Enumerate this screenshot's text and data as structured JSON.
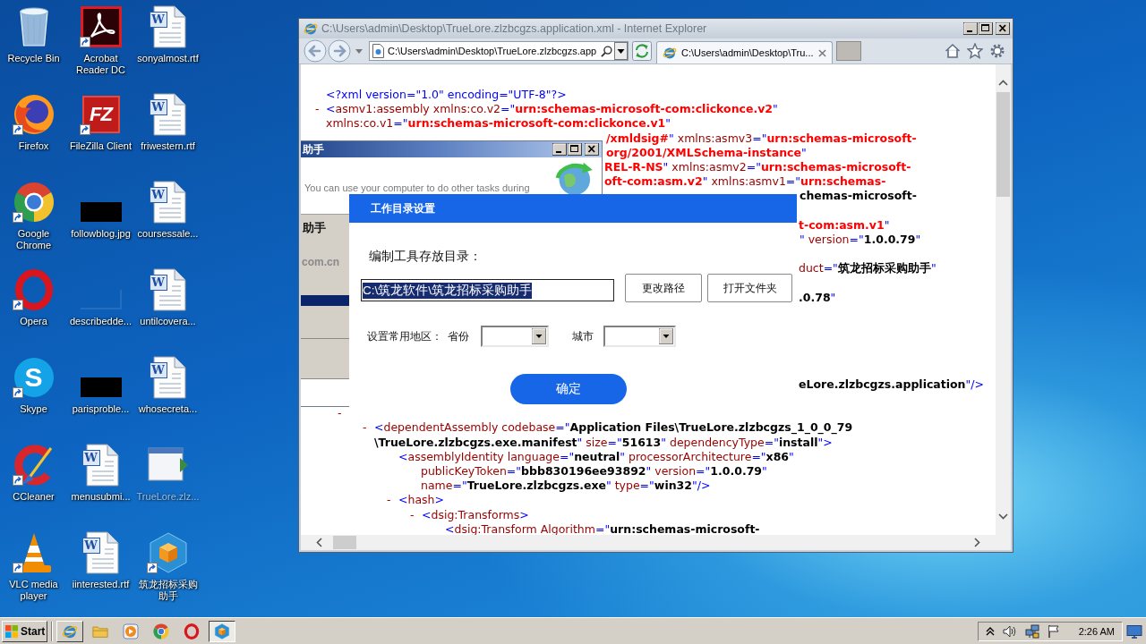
{
  "desktop": {
    "icons": [
      {
        "label": "Recycle Bin",
        "kind": "recycle-bin",
        "shortcut": false,
        "ghosted": false
      },
      {
        "label": "Firefox",
        "kind": "firefox",
        "shortcut": true,
        "ghosted": false
      },
      {
        "label": "Google Chrome",
        "kind": "chrome",
        "shortcut": true,
        "ghosted": false
      },
      {
        "label": "Opera",
        "kind": "opera",
        "shortcut": true,
        "ghosted": false
      },
      {
        "label": "Skype",
        "kind": "skype",
        "badge": "S",
        "shortcut": true,
        "ghosted": false
      },
      {
        "label": "CCleaner",
        "kind": "ccleaner",
        "shortcut": true,
        "ghosted": false
      },
      {
        "label": "VLC media player",
        "kind": "vlc",
        "shortcut": true,
        "ghosted": false
      },
      {
        "label": "Acrobat Reader DC",
        "kind": "acrobat",
        "shortcut": true,
        "ghosted": false
      },
      {
        "label": "FileZilla Client",
        "kind": "filezilla",
        "badge": "FZ",
        "shortcut": true,
        "ghosted": false
      },
      {
        "label": "followblog.jpg",
        "kind": "image",
        "shortcut": false,
        "ghosted": false
      },
      {
        "label": "describedde...",
        "kind": "image-blank",
        "shortcut": false,
        "ghosted": false
      },
      {
        "label": "parisproble...",
        "kind": "image",
        "shortcut": false,
        "ghosted": false
      },
      {
        "label": "menusubmi...",
        "kind": "document",
        "badge": "W",
        "shortcut": false,
        "ghosted": false
      },
      {
        "label": "iinterested.rtf",
        "kind": "document",
        "badge": "W",
        "shortcut": false,
        "ghosted": false
      },
      {
        "label": "sonyalmost.rtf",
        "kind": "document",
        "badge": "W",
        "shortcut": false,
        "ghosted": false
      },
      {
        "label": "friwestern.rtf",
        "kind": "document",
        "badge": "W",
        "shortcut": false,
        "ghosted": false
      },
      {
        "label": "coursessale...",
        "kind": "document",
        "badge": "W",
        "shortcut": false,
        "ghosted": false
      },
      {
        "label": "untilcovera...",
        "kind": "document",
        "badge": "W",
        "shortcut": false,
        "ghosted": false
      },
      {
        "label": "whosecreta...",
        "kind": "document",
        "badge": "W",
        "shortcut": false,
        "ghosted": false
      },
      {
        "label": "TrueLore.zlz...",
        "kind": "app-window",
        "shortcut": false,
        "ghosted": true
      },
      {
        "label": "筑龙招标采购助手",
        "kind": "cube-app",
        "shortcut": true,
        "ghosted": false
      }
    ]
  },
  "browser_window": {
    "title": "C:\\Users\\admin\\Desktop\\TrueLore.zlzbcgzs.application.xml - Internet Explorer",
    "active": false,
    "address": "C:\\Users\\admin\\Desktop\\TrueLore.zlzbcgzs.app",
    "tabs": [
      {
        "label": "C:\\Users\\admin\\Desktop\\Tru...",
        "selected": true
      }
    ],
    "xml_lines": [
      {
        "parts": [
          {
            "kind": "markup",
            "text": "<?xml version=\"1.0\" encoding=\"UTF-8\"?>"
          }
        ]
      },
      {
        "fold": "-",
        "parts": [
          {
            "kind": "markup",
            "text": "<"
          },
          {
            "kind": "name",
            "text": "asmv1:assembly"
          },
          {
            "kind": "name",
            "text": " xmlns:co.v2"
          },
          {
            "kind": "markup",
            "text": "=\""
          },
          {
            "kind": "ns",
            "text": "urn:schemas-microsoft-com:clickonce.v2"
          },
          {
            "kind": "markup",
            "text": "\""
          }
        ]
      },
      {
        "parts": [
          {
            "kind": "name",
            "text": "xmlns:co.v1"
          },
          {
            "kind": "markup",
            "text": "=\""
          },
          {
            "kind": "ns",
            "text": "urn:schemas-microsoft-com:clickonce.v1"
          },
          {
            "kind": "markup",
            "text": "\""
          }
        ]
      },
      {
        "parts": [
          {
            "kind": "ns",
            "text": "/xmldsig#"
          },
          {
            "kind": "markup",
            "text": "\""
          },
          {
            "kind": "name",
            "text": " xmlns:asmv3"
          },
          {
            "kind": "markup",
            "text": "=\""
          },
          {
            "kind": "ns",
            "text": "urn:schemas-microsoft-"
          }
        ]
      },
      {
        "parts": [
          {
            "kind": "ns",
            "text": "org/2001/XMLSchema-instance"
          },
          {
            "kind": "markup",
            "text": "\""
          }
        ]
      },
      {
        "parts": [
          {
            "kind": "ns",
            "text": "REL-R-NS"
          },
          {
            "kind": "markup",
            "text": "\""
          },
          {
            "kind": "name",
            "text": " xmlns:asmv2"
          },
          {
            "kind": "markup",
            "text": "=\""
          },
          {
            "kind": "ns",
            "text": "urn:schemas-microsoft-"
          }
        ]
      },
      {
        "parts": [
          {
            "kind": "ns",
            "text": "oft-com:asm.v2"
          },
          {
            "kind": "markup",
            "text": "\""
          },
          {
            "kind": "name",
            "text": " xmlns:asmv1"
          },
          {
            "kind": "markup",
            "text": "=\""
          },
          {
            "kind": "ns",
            "text": "urn:schemas-"
          }
        ]
      },
      {
        "parts": [
          {
            "kind": "value",
            "text": "chemas-microsoft-"
          }
        ]
      },
      {
        "parts": [
          {
            "kind": "ns",
            "text": "t-com:asm.v1"
          },
          {
            "kind": "markup",
            "text": "\""
          }
        ]
      },
      {
        "parts": [
          {
            "kind": "markup",
            "text": "\""
          },
          {
            "kind": "name",
            "text": " version"
          },
          {
            "kind": "markup",
            "text": "=\""
          },
          {
            "kind": "value",
            "text": "1.0.0.79"
          },
          {
            "kind": "markup",
            "text": "\""
          }
        ]
      },
      {
        "parts": [
          {
            "kind": "name",
            "text": "duct"
          },
          {
            "kind": "markup",
            "text": "=\""
          },
          {
            "kind": "value",
            "text": "筑龙招标采购助手"
          },
          {
            "kind": "markup",
            "text": "\""
          }
        ]
      },
      {
        "parts": [
          {
            "kind": "value",
            "text": ".0.78"
          },
          {
            "kind": "markup",
            "text": "\""
          }
        ]
      },
      {
        "parts": [
          {
            "kind": "value",
            "text": "eLore.zlzbcgzs.application"
          },
          {
            "kind": "markup",
            "text": "\"/>"
          }
        ]
      },
      {
        "fold": "-"
      },
      {
        "fold": "-",
        "parts": [
          {
            "kind": "markup",
            "text": "<"
          },
          {
            "kind": "name",
            "text": "dependentAssembly"
          },
          {
            "kind": "name",
            "text": " codebase"
          },
          {
            "kind": "markup",
            "text": "=\""
          },
          {
            "kind": "value",
            "text": "Application Files\\TrueLore.zlzbcgzs_1_0_0_79"
          }
        ]
      },
      {
        "parts": [
          {
            "kind": "value",
            "text": "\\TrueLore.zlzbcgzs.exe.manifest"
          },
          {
            "kind": "markup",
            "text": "\""
          },
          {
            "kind": "name",
            "text": " size"
          },
          {
            "kind": "markup",
            "text": "=\""
          },
          {
            "kind": "value",
            "text": "51613"
          },
          {
            "kind": "markup",
            "text": "\""
          },
          {
            "kind": "name",
            "text": " dependencyType"
          },
          {
            "kind": "markup",
            "text": "=\""
          },
          {
            "kind": "value",
            "text": "install"
          },
          {
            "kind": "markup",
            "text": "\">"
          }
        ]
      },
      {
        "parts": [
          {
            "kind": "markup",
            "text": "<"
          },
          {
            "kind": "name",
            "text": "assemblyIdentity"
          },
          {
            "kind": "name",
            "text": " language"
          },
          {
            "kind": "markup",
            "text": "=\""
          },
          {
            "kind": "value",
            "text": "neutral"
          },
          {
            "kind": "markup",
            "text": "\""
          },
          {
            "kind": "name",
            "text": " processorArchitecture"
          },
          {
            "kind": "markup",
            "text": "=\""
          },
          {
            "kind": "value",
            "text": "x86"
          },
          {
            "kind": "markup",
            "text": "\""
          }
        ]
      },
      {
        "parts": [
          {
            "kind": "name",
            "text": "publicKeyToken"
          },
          {
            "kind": "markup",
            "text": "=\""
          },
          {
            "kind": "value",
            "text": "bbb830196ee93892"
          },
          {
            "kind": "markup",
            "text": "\""
          },
          {
            "kind": "name",
            "text": " version"
          },
          {
            "kind": "markup",
            "text": "=\""
          },
          {
            "kind": "value",
            "text": "1.0.0.79"
          },
          {
            "kind": "markup",
            "text": "\""
          }
        ]
      },
      {
        "parts": [
          {
            "kind": "name",
            "text": "name"
          },
          {
            "kind": "markup",
            "text": "=\""
          },
          {
            "kind": "value",
            "text": "TrueLore.zlzbcgzs.exe"
          },
          {
            "kind": "markup",
            "text": "\""
          },
          {
            "kind": "name",
            "text": " type"
          },
          {
            "kind": "markup",
            "text": "=\""
          },
          {
            "kind": "value",
            "text": "win32"
          },
          {
            "kind": "markup",
            "text": "\"/>"
          }
        ]
      },
      {
        "fold": "-",
        "parts": [
          {
            "kind": "markup",
            "text": "<"
          },
          {
            "kind": "name",
            "text": "hash"
          },
          {
            "kind": "markup",
            "text": ">"
          }
        ]
      },
      {
        "fold": "-",
        "parts": [
          {
            "kind": "markup",
            "text": "<"
          },
          {
            "kind": "name",
            "text": "dsig:Transforms"
          },
          {
            "kind": "markup",
            "text": ">"
          }
        ]
      },
      {
        "parts": [
          {
            "kind": "markup",
            "text": "<"
          },
          {
            "kind": "name",
            "text": "dsig:Transform"
          },
          {
            "kind": "name",
            "text": " Algorithm"
          },
          {
            "kind": "markup",
            "text": "=\""
          },
          {
            "kind": "value",
            "text": "urn:schemas-microsoft-"
          }
        ]
      }
    ]
  },
  "installer_window": {
    "title": "助手",
    "message": "You can use your computer to do other tasks during",
    "side_heading": "助手",
    "side_site": "com.cn"
  },
  "settings_dialog": {
    "title": "工作目录设置",
    "path_label": "编制工具存放目录：",
    "path_field": {
      "value": "C:\\筑龙软件\\筑龙招标采购助手",
      "text_selected": true
    },
    "buttons": [
      "更改路径",
      "打开文件夹"
    ],
    "region_label": "设置常用地区：",
    "province_label": "省份",
    "city_label": "城市",
    "confirm": "确定"
  },
  "taskbar": {
    "start": "Start",
    "items": [
      {
        "kind": "browser",
        "open": true,
        "selected": false
      },
      {
        "kind": "folder",
        "open": false,
        "selected": false
      },
      {
        "kind": "media-player",
        "open": false,
        "selected": false
      },
      {
        "kind": "chrome",
        "open": false,
        "selected": false
      },
      {
        "kind": "opera",
        "open": false,
        "selected": false
      },
      {
        "kind": "cube-app",
        "open": true,
        "selected": true
      }
    ],
    "clock": "2:26 AM"
  }
}
